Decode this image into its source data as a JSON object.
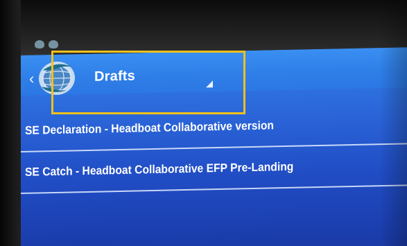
{
  "actionbar": {
    "back_icon": "chevron-left-icon",
    "logo_icon": "globe-logo-icon",
    "spinner_label": "Drafts",
    "spinner_icon": "dropdown-triangle-icon"
  },
  "list": {
    "items": [
      {
        "label": "SE Declaration - Headboat Collaborative version"
      },
      {
        "label": "SE Catch - Headboat Collaborative EFP Pre-Landing"
      }
    ]
  },
  "colors": {
    "highlight": "#f2c11b",
    "actionbar": "#2f7fe8",
    "background": "#214ec6"
  }
}
